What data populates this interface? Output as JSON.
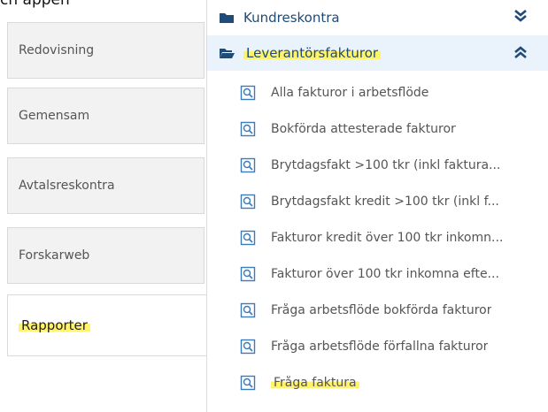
{
  "caption": {
    "partial_text": "ch appen"
  },
  "left_tabs": [
    {
      "label": "Redovisning"
    },
    {
      "label": "Gemensam"
    },
    {
      "label": "Avtalsreskontra"
    },
    {
      "label": "Forskarweb"
    },
    {
      "label": "Rapporter",
      "active": true,
      "highlighted": true
    }
  ],
  "groups": {
    "collapsed": {
      "label": "Kundreskontra",
      "icon": "folder-closed-icon",
      "chevron": "chevron-double-down-icon"
    },
    "expanded": {
      "label": "Leverantörsfakturor",
      "icon": "folder-open-icon",
      "chevron": "chevron-double-up-icon",
      "highlighted": true
    }
  },
  "report_items": [
    {
      "label": "Alla fakturor i arbetsflöde"
    },
    {
      "label": "Bokförda attesterade fakturor"
    },
    {
      "label": "Brytdagsfakt >100 tkr (inkl faktura..."
    },
    {
      "label": "Brytdagsfakt kredit >100 tkr (inkl f..."
    },
    {
      "label": "Fakturor kredit över 100 tkr inkomn..."
    },
    {
      "label": "Fakturor över 100 tkr inkomna efte..."
    },
    {
      "label": "Fråga arbetsflöde bokförda fakturor"
    },
    {
      "label": "Fråga arbetsflöde förfallna fakturor"
    },
    {
      "label": "Fråga faktura",
      "highlighted": true
    }
  ],
  "colors": {
    "accent": "#1f4b78",
    "highlight": "#fff36b",
    "expanded_bg": "#eaf3fb"
  }
}
